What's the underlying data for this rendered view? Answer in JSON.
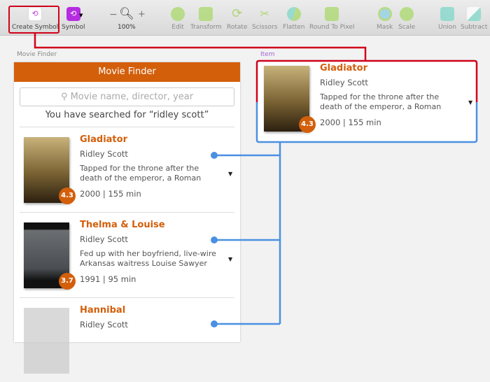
{
  "toolbar": {
    "items": [
      {
        "label": "Create Symbol",
        "icon": "create-symbol-icon"
      },
      {
        "label": "Symbol",
        "icon": "symbol-icon"
      },
      {
        "label": "100%",
        "icon": "zoom-icon"
      },
      {
        "label": "Edit",
        "icon": "edit-icon"
      },
      {
        "label": "Transform",
        "icon": "transform-icon"
      },
      {
        "label": "Rotate",
        "icon": "rotate-icon"
      },
      {
        "label": "Scissors",
        "icon": "scissors-icon"
      },
      {
        "label": "Flatten",
        "icon": "flatten-icon"
      },
      {
        "label": "Round To Pixel",
        "icon": "round-to-pixel-icon"
      },
      {
        "label": "Mask",
        "icon": "mask-icon"
      },
      {
        "label": "Scale",
        "icon": "scale-icon"
      },
      {
        "label": "Union",
        "icon": "union-icon"
      },
      {
        "label": "Subtract",
        "icon": "subtract-icon"
      }
    ],
    "zoom_minus": "−",
    "zoom_plus": "+"
  },
  "artboards": {
    "finder_label": "Movie Finder",
    "item_label": "Item"
  },
  "finder": {
    "title": "Movie Finder",
    "search_placeholder": "Movie name, director, year",
    "searched": "You have searched for “ridley scott”",
    "movies": [
      {
        "title": "Gladiator",
        "director": "Ridley Scott",
        "desc1": "Tapped for the throne after the",
        "desc2": "death of the emperor, a Roman",
        "meta": "2000  |  155 min",
        "rating": "4.3"
      },
      {
        "title": "Thelma & Louise",
        "director": "Ridley Scott",
        "desc1": "Fed up with her boyfriend, live-wire",
        "desc2": "Arkansas waitress Louise Sawyer",
        "meta": "1991  |  95 min",
        "rating": "3.7"
      },
      {
        "title": "Hannibal",
        "director": "Ridley Scott"
      }
    ]
  },
  "item": {
    "title": "Gladiator",
    "director": "Ridley Scott",
    "desc1": "Tapped for the throne after the",
    "desc2": "death of the emperor, a Roman",
    "meta": "2000  |  155 min",
    "rating": "4.3"
  },
  "colors": {
    "accent": "#d35f0b",
    "selection": "#d0021b",
    "link": "#4a90e2"
  }
}
